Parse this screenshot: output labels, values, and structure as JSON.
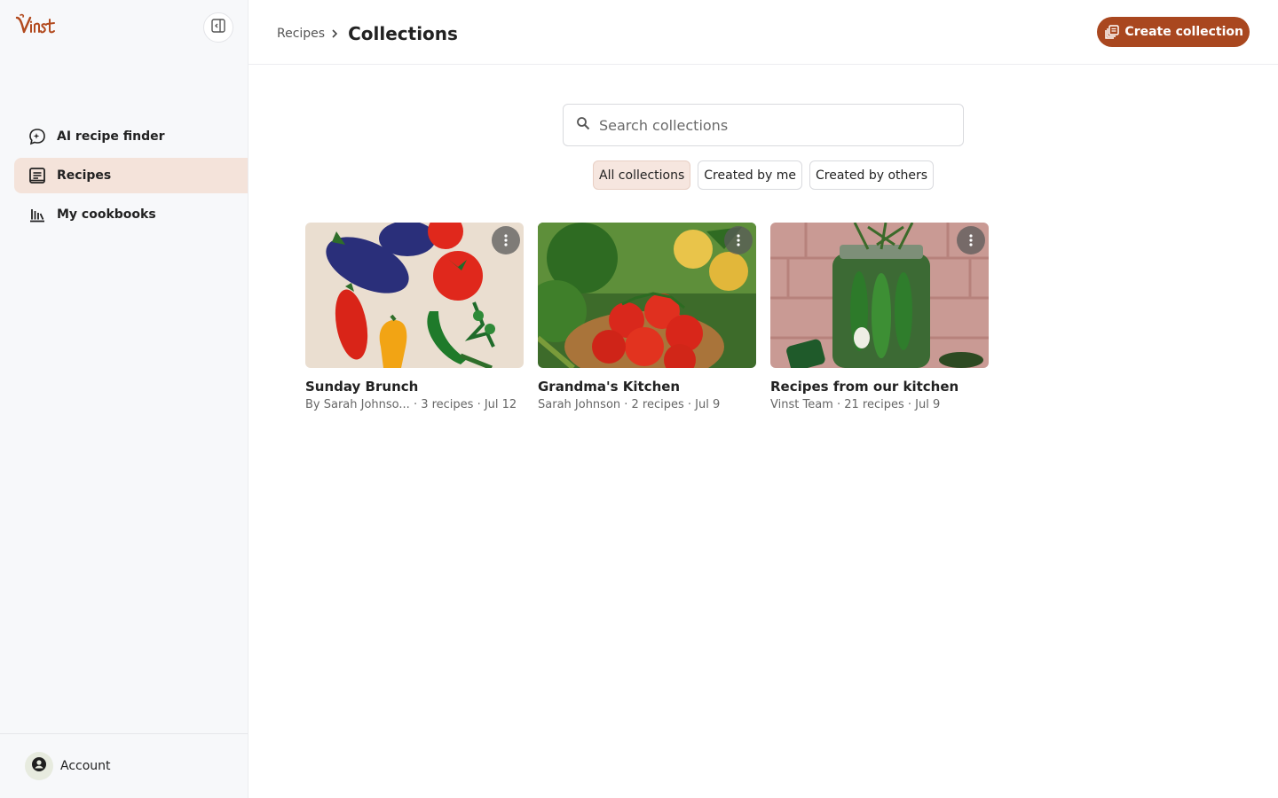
{
  "app": {
    "logo_text": "Vinst"
  },
  "sidebar": {
    "items": [
      {
        "label": "AI recipe finder",
        "icon": "ai-chat-icon"
      },
      {
        "label": "Recipes",
        "icon": "recipe-book-icon",
        "active": true
      },
      {
        "label": "My cookbooks",
        "icon": "bookshelf-icon"
      }
    ],
    "account_label": "Account"
  },
  "header": {
    "breadcrumb_parent": "Recipes",
    "title": "Collections",
    "create_label": "Create collection"
  },
  "search": {
    "placeholder": "Search collections",
    "value": ""
  },
  "filters": [
    {
      "label": "All collections",
      "active": true
    },
    {
      "label": "Created by me",
      "active": false
    },
    {
      "label": "Created by others",
      "active": false
    }
  ],
  "collections": [
    {
      "title": "Sunday Brunch",
      "meta": "By Sarah Johnso... · 3 recipes · Jul 12"
    },
    {
      "title": "Grandma's Kitchen",
      "meta": "Sarah Johnson · 2 recipes · Jul 9"
    },
    {
      "title": "Recipes from our kitchen",
      "meta": "Vinst Team · 21 recipes · Jul 9"
    }
  ],
  "colors": {
    "accent": "#a9471f",
    "active_nav": "#f4e3da",
    "sidebar_bg": "#f7f8fa"
  }
}
